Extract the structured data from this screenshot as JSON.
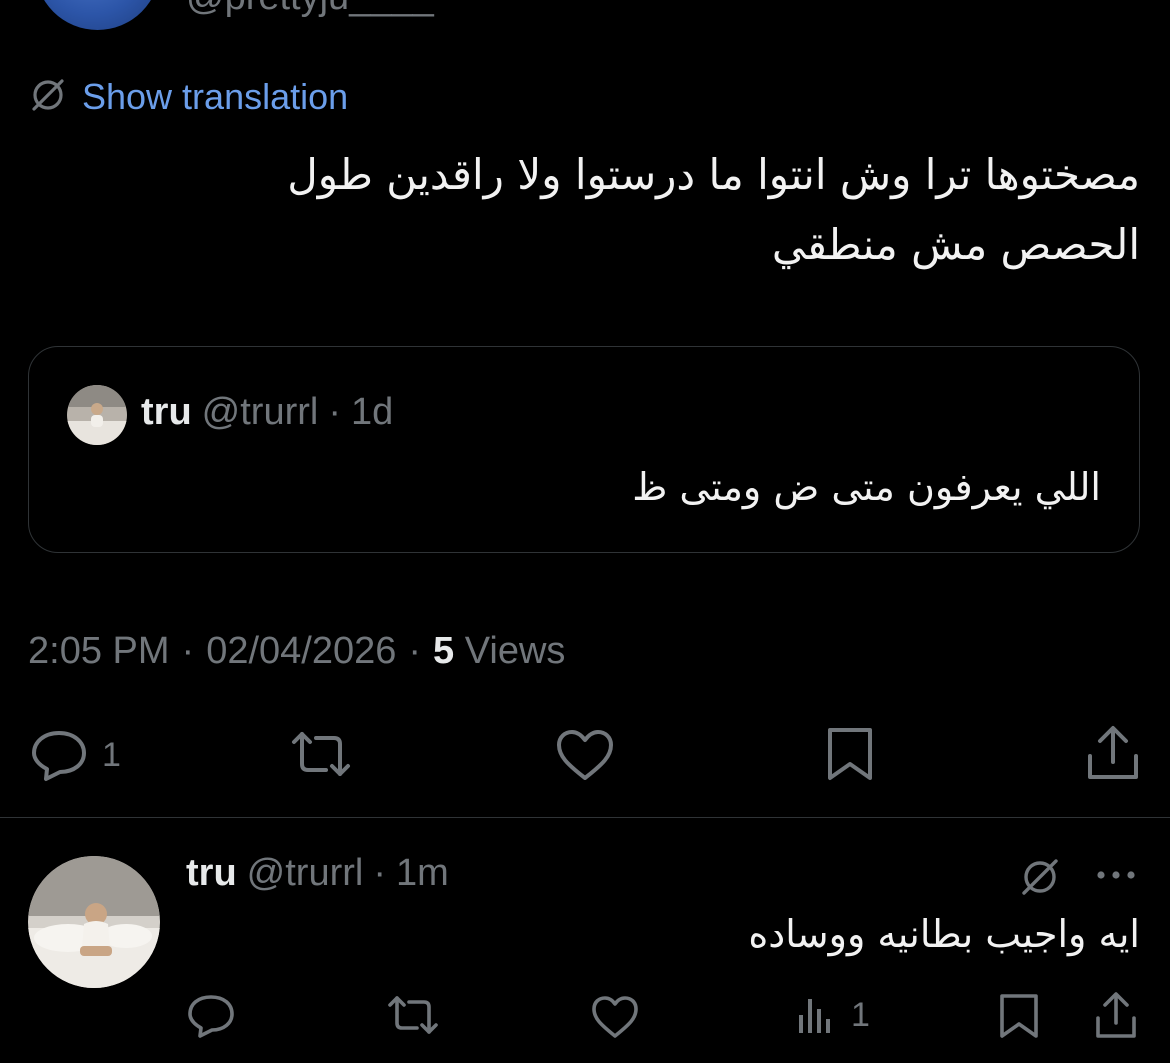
{
  "header": {
    "handle": "@prettyju____"
  },
  "translation": {
    "label": "Show translation"
  },
  "tweet": {
    "text_line1": "مصختوها ترا وش انتوا ما درستوا ولا راقدين طول",
    "text_line2": "الحصص مش منطقي",
    "time": "2:05 PM",
    "date": "02/04/2026",
    "views_count": "5",
    "views_label": "Views",
    "replies_count": "1"
  },
  "quote": {
    "name": "tru",
    "handle": "@trurrl",
    "separator": "·",
    "age": "1d",
    "text": "اللي يعرفون متى ض ومتى ظ"
  },
  "reply": {
    "name": "tru",
    "handle": "@trurrl",
    "separator": "·",
    "age": "1m",
    "text": "ايه واجيب بطانيه ووساده",
    "views_count": "1"
  },
  "meta_separator": "·",
  "colors": {
    "background": "#000000",
    "text": "#e7e9ea",
    "muted": "#71767b",
    "link": "#6b9eea",
    "border": "#2f3336"
  },
  "icons": {
    "translate": "translate-icon",
    "reply": "reply-icon",
    "retweet": "retweet-icon",
    "like": "like-icon",
    "bookmark": "bookmark-icon",
    "share": "share-icon",
    "views": "views-icon",
    "more": "more-icon"
  }
}
